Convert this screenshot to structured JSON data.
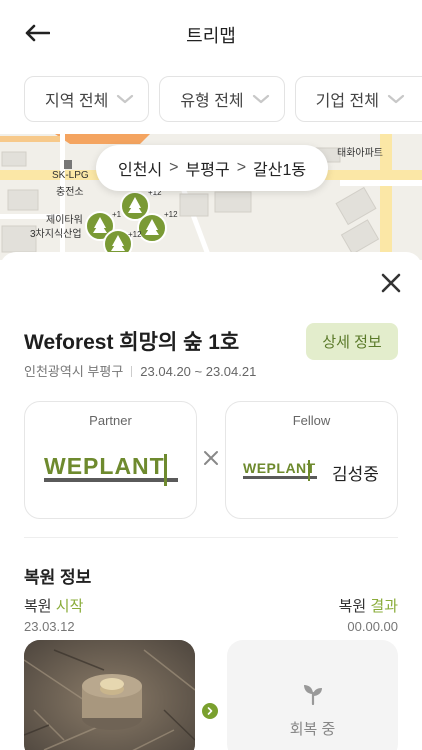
{
  "header": {
    "title": "트리맵",
    "back_icon": "back-arrow-icon"
  },
  "filters": [
    {
      "label": "지역 전체"
    },
    {
      "label": "유형 전체"
    },
    {
      "label": "기업 전체"
    }
  ],
  "map": {
    "labels": {
      "apartment": "태화아파트",
      "gas_station_1": "SK-LPG",
      "gas_station_2": "충전소",
      "building_1": "제이타워",
      "building_2": "3차지식산업",
      "cluster_1": "+1",
      "cluster_2": "+12",
      "cluster_3": "+12",
      "cluster_4": "+12"
    },
    "breadcrumb": {
      "city": "인천시",
      "district": "부평구",
      "neighborhood": "갈산1동",
      "separator": ">"
    }
  },
  "detail": {
    "close_icon": "close-icon",
    "title": "Weforest 희망의 숲 1호",
    "detail_button": "상세 정보",
    "location": "인천광역시 부평구",
    "period": "23.04.20 ~ 23.04.21",
    "partner": {
      "label": "Partner",
      "logo_text": "WEPLANT"
    },
    "fellow": {
      "label": "Fellow",
      "logo_text": "WEPLANT",
      "name": "김성중"
    }
  },
  "restoration": {
    "section_title": "복원 정보",
    "start": {
      "prefix": "복원",
      "highlight": "시작",
      "date": "23.03.12"
    },
    "end": {
      "prefix": "복원",
      "highlight": "결과",
      "date": "00.00.00"
    },
    "status": "회복 중"
  },
  "colors": {
    "accent_green": "#8aac3a",
    "button_bg": "#e3edcc",
    "button_text": "#5b7a2a",
    "pin_green": "#7a9a35"
  }
}
